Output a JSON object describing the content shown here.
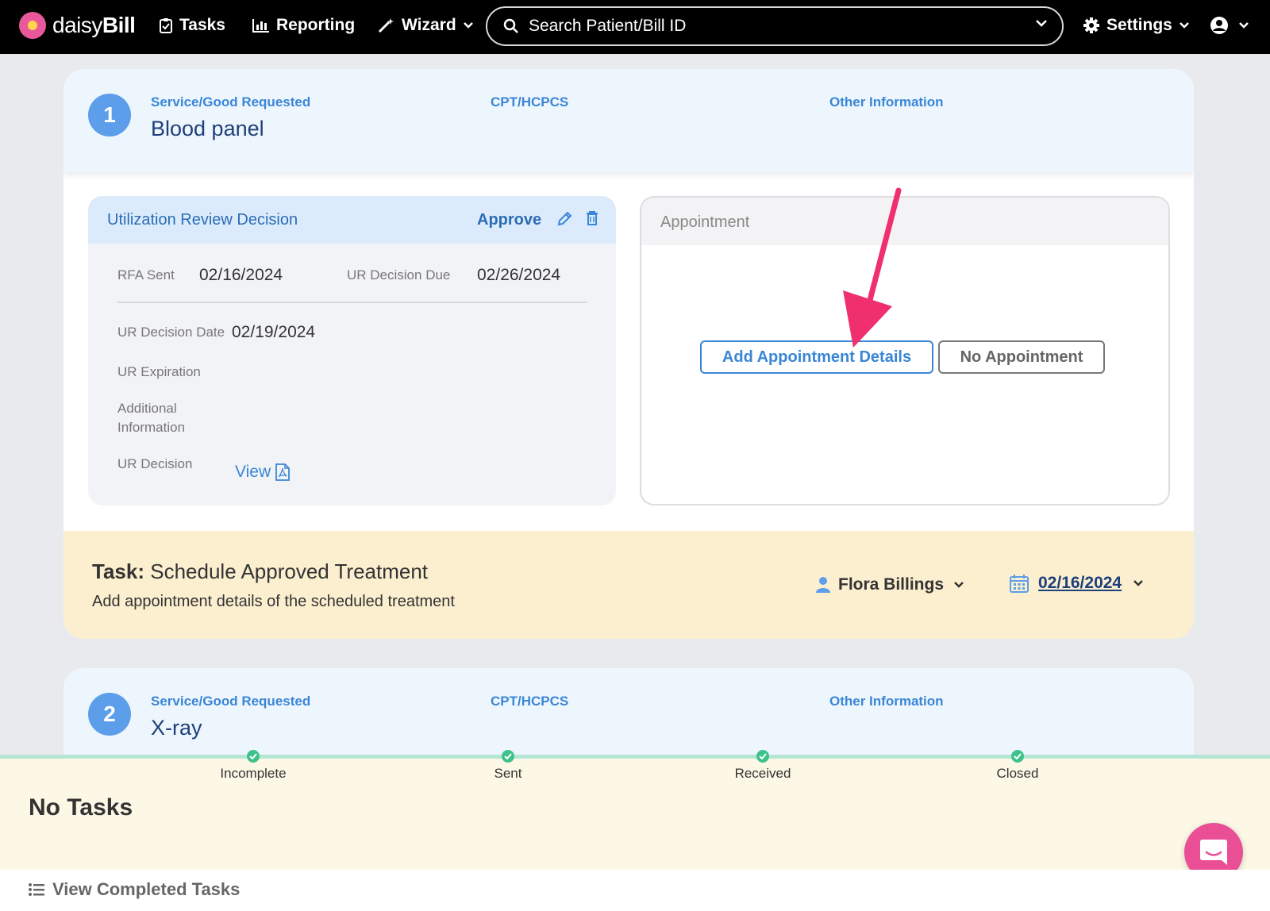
{
  "nav": {
    "brand_light": "daisy",
    "brand_bold": "Bill",
    "tasks": "Tasks",
    "reporting": "Reporting",
    "wizard": "Wizard",
    "search_placeholder": "Search Patient/Bill ID",
    "settings": "Settings"
  },
  "services": [
    {
      "number": "1",
      "service_label": "Service/Good Requested",
      "service_value": "Blood panel",
      "cpt_label": "CPT/HCPCS",
      "other_label": "Other Information"
    },
    {
      "number": "2",
      "service_label": "Service/Good Requested",
      "service_value": "X-ray",
      "cpt_label": "CPT/HCPCS",
      "other_label": "Other Information"
    }
  ],
  "ur": {
    "title": "Utilization Review Decision",
    "decision": "Approve",
    "rfa_sent_label": "RFA Sent",
    "rfa_sent_value": "02/16/2024",
    "decision_due_label": "UR Decision Due",
    "decision_due_value": "02/26/2024",
    "decision_date_label": "UR Decision Date",
    "decision_date_value": "02/19/2024",
    "expiration_label": "UR Expiration",
    "additional_label_1": "Additional",
    "additional_label_2": "Information",
    "ur_decision_label": "UR Decision",
    "view_link": "View"
  },
  "appointment": {
    "title": "Appointment",
    "add_button": "Add Appointment Details",
    "no_button": "No Appointment"
  },
  "task": {
    "prefix": "Task:",
    "title": "Schedule Approved Treatment",
    "subtitle": "Add appointment details of the scheduled treatment",
    "assignee": "Flora Billings",
    "due_date": "02/16/2024"
  },
  "tracker": {
    "steps": [
      "Incomplete",
      "Sent",
      "Received",
      "Closed"
    ],
    "no_tasks": "No Tasks",
    "view_completed": "View Completed Tasks"
  },
  "colors": {
    "accent_blue": "#3a86d6",
    "annotation_arrow": "#f0306e",
    "task_banner": "#fcefd0",
    "chat_button": "#ea4f95"
  }
}
